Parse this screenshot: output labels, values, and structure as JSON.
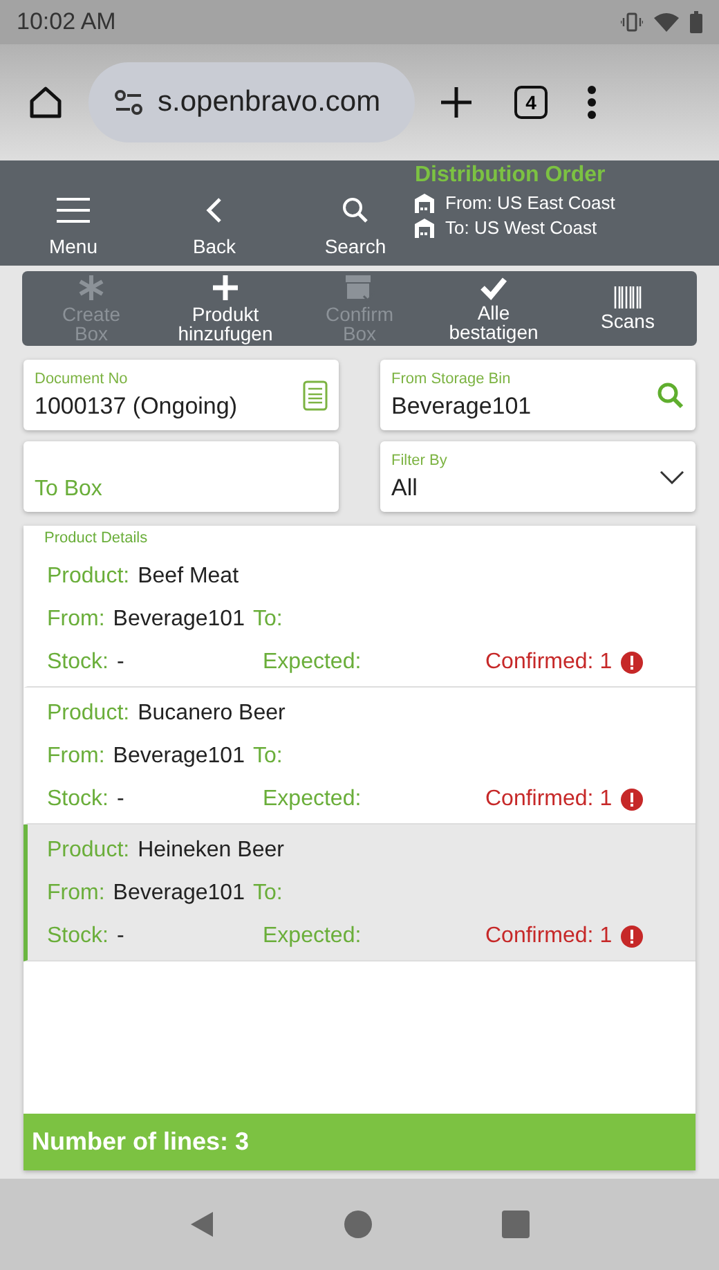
{
  "status_bar": {
    "time": "10:02 AM"
  },
  "browser": {
    "url": "s.openbravo.com",
    "tab_count": "4"
  },
  "header": {
    "nav": [
      {
        "kind": "menu",
        "label": "Menu"
      },
      {
        "kind": "back",
        "label": "Back"
      },
      {
        "kind": "search",
        "label": "Search"
      }
    ],
    "title": "Distribution Order",
    "from": "From: US East Coast",
    "to": "To: US West Coast"
  },
  "actions": [
    {
      "kind": "create",
      "label": "Create Box",
      "disabled": true
    },
    {
      "kind": "add",
      "label": "Produkt hinzufugen",
      "disabled": false
    },
    {
      "kind": "box",
      "label": "Confirm Box",
      "disabled": true
    },
    {
      "kind": "check",
      "label": "Alle bestatigen",
      "disabled": false
    },
    {
      "kind": "barcode",
      "label": "Scans",
      "disabled": false
    }
  ],
  "fields": {
    "document": {
      "label": "Document No",
      "value": "1000137 (Ongoing)"
    },
    "bin": {
      "label": "From Storage Bin",
      "value": "Beverage101"
    },
    "to_box": {
      "placeholder": "To Box"
    },
    "filter": {
      "label": "Filter By",
      "value": "All"
    }
  },
  "product_details": {
    "title": "Product Details",
    "items": [
      {
        "product_label": "Product:",
        "product": "Beef Meat",
        "from_label": "From:",
        "from": "Beverage101",
        "to_label": "To:",
        "stock_label": "Stock:",
        "stock": "-",
        "expected_label": "Expected:",
        "confirmed": "Confirmed: 1",
        "warning": true,
        "selected": false
      },
      {
        "product_label": "Product:",
        "product": "Bucanero Beer",
        "from_label": "From:",
        "from": "Beverage101",
        "to_label": "To:",
        "stock_label": "Stock:",
        "stock": "-",
        "expected_label": "Expected:",
        "confirmed": "Confirmed: 1",
        "warning": true,
        "selected": false
      },
      {
        "product_label": "Product:",
        "product": "Heineken Beer",
        "from_label": "From:",
        "from": "Beverage101",
        "to_label": "To:",
        "stock_label": "Stock:",
        "stock": "-",
        "expected_label": "Expected:",
        "confirmed": "Confirmed: 1",
        "warning": true,
        "selected": true
      }
    ]
  },
  "footer": "Number of lines: 3"
}
